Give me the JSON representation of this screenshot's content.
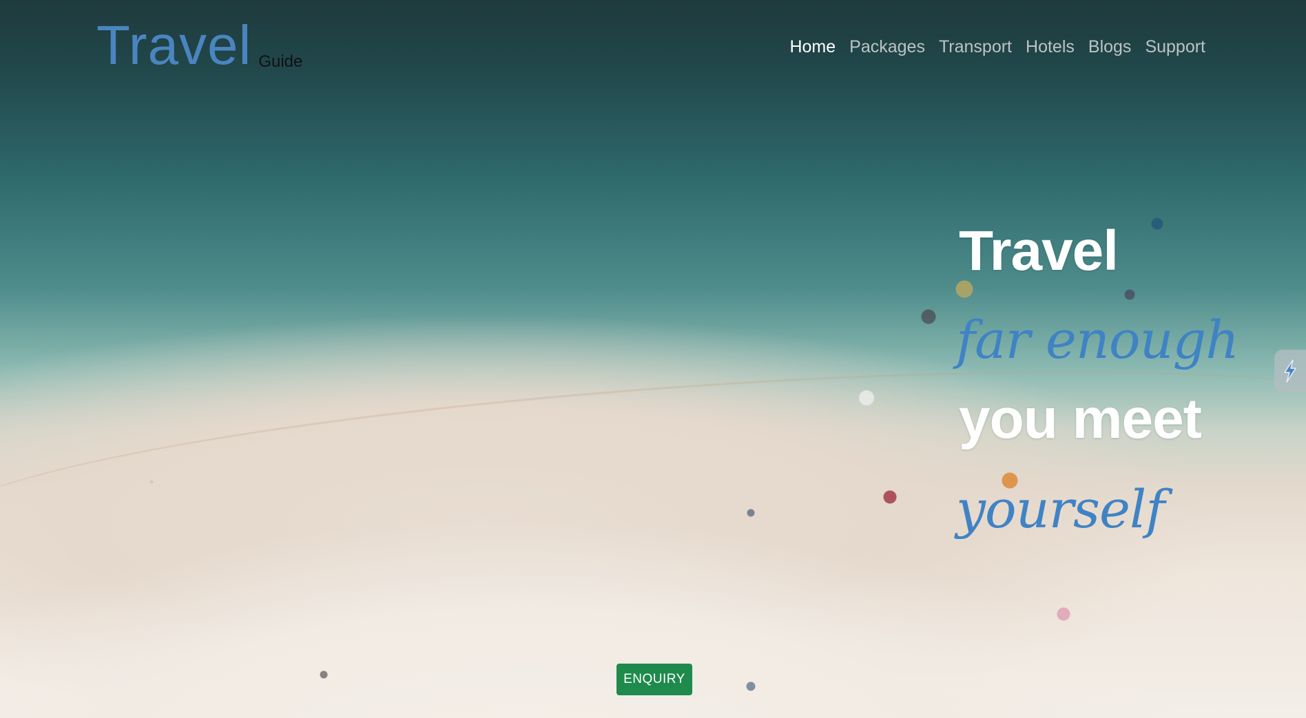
{
  "brand": {
    "main": "Travel",
    "sub": "Guide"
  },
  "nav": {
    "items": [
      {
        "label": "Home",
        "active": true
      },
      {
        "label": "Packages",
        "active": false
      },
      {
        "label": "Transport",
        "active": false
      },
      {
        "label": "Hotels",
        "active": false
      },
      {
        "label": "Blogs",
        "active": false
      },
      {
        "label": "Support",
        "active": false
      }
    ]
  },
  "hero": {
    "lines": [
      {
        "text": "Travel",
        "style": "plain"
      },
      {
        "text": "far enough",
        "style": "script"
      },
      {
        "text": "you meet",
        "style": "plain"
      },
      {
        "text": "yourself",
        "style": "script"
      }
    ],
    "cta_label": "ENQUIRY"
  },
  "side_widget": {
    "icon": "lightning-bolt-icon"
  },
  "colors": {
    "brand_blue": "#4a85c0",
    "script_blue": "#3f83c4",
    "cta_green": "#1e8a4c"
  }
}
